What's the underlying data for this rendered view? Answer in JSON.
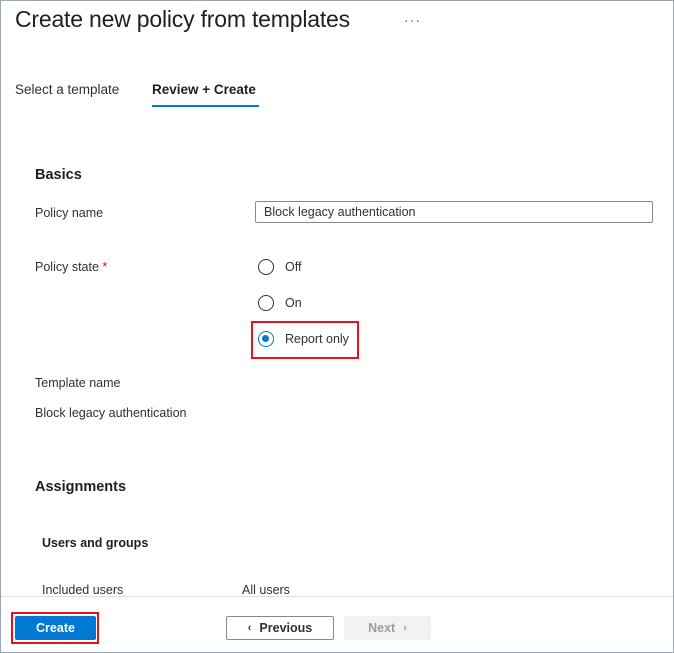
{
  "header": {
    "title": "Create new policy from templates",
    "more": "···"
  },
  "tabs": [
    {
      "label": "Select a template",
      "active": false
    },
    {
      "label": "Review + Create",
      "active": true
    }
  ],
  "basics": {
    "heading": "Basics",
    "policy_name_label": "Policy name",
    "policy_name_value": "Block legacy authentication",
    "policy_state_label": "Policy state",
    "required_mark": "*",
    "states": [
      {
        "label": "Off",
        "checked": false
      },
      {
        "label": "On",
        "checked": false
      },
      {
        "label": "Report only",
        "checked": true
      }
    ],
    "template_name_label": "Template name",
    "template_name_value": "Block legacy authentication"
  },
  "assignments": {
    "heading": "Assignments",
    "users_groups_heading": "Users and groups",
    "included_users_label": "Included users",
    "included_users_value": "All users"
  },
  "footer": {
    "create_label": "Create",
    "previous_label": "Previous",
    "next_label": "Next",
    "prev_icon": "‹",
    "next_icon": "›"
  },
  "colors": {
    "accent": "#0078d4",
    "highlight": "#e81123",
    "required": "#a4262c"
  }
}
